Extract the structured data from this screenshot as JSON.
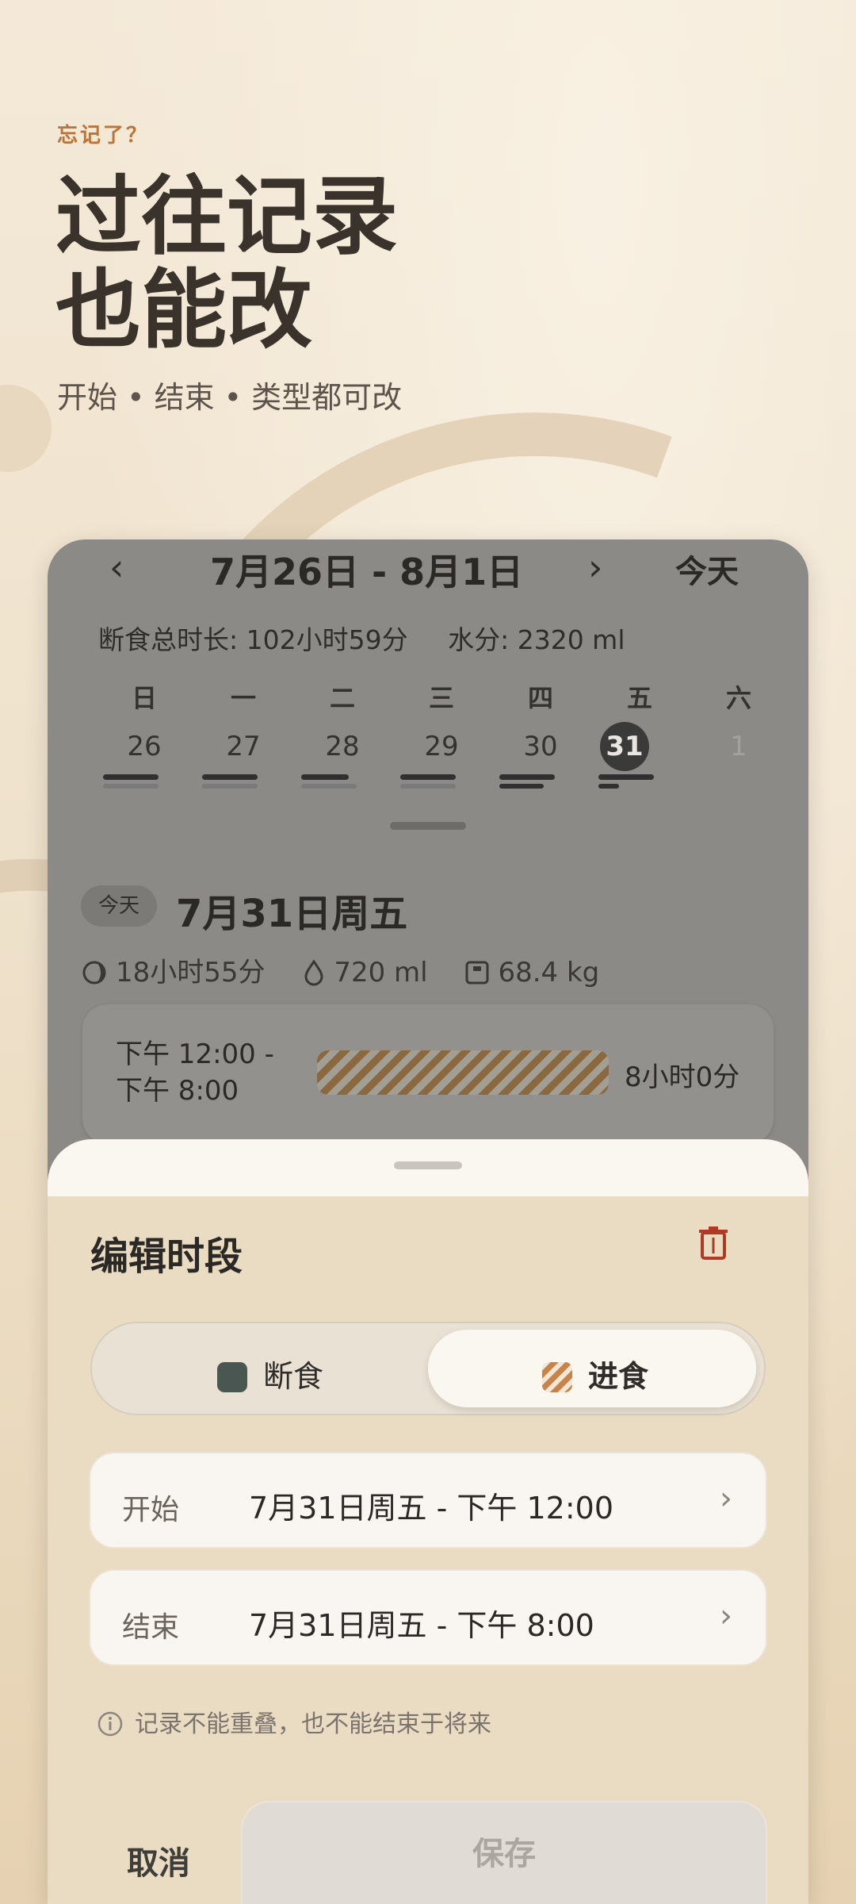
{
  "intro": {
    "eyebrow": "忘记了？",
    "headline_line1": "过往记录",
    "headline_line2": "也能改",
    "subtitle": "开始 • 结束 • 类型都可改"
  },
  "calendar": {
    "prev_icon": "chevron-left-icon",
    "next_icon": "chevron-right-icon",
    "range": "7月26日 - 8月1日",
    "today_button": "今天",
    "summary_fast": "断食总时长: 102小时59分",
    "summary_water": "水分:  2320 ml",
    "weekdays": [
      "日",
      "一",
      "二",
      "三",
      "四",
      "五",
      "六"
    ],
    "days": [
      "26",
      "27",
      "28",
      "29",
      "30",
      "31",
      "1"
    ],
    "selected_day": "31",
    "day_pill": "今天",
    "day_title": "7月31日周五",
    "stats": {
      "fast": "18小时55分",
      "water": "720 ml",
      "weight": "68.4 kg"
    },
    "entry": {
      "time": "下午 12:00 - 下午 8:00",
      "duration": "8小时0分"
    }
  },
  "sheet": {
    "title": "编辑时段",
    "delete_icon": "trash-icon",
    "options": {
      "fasting": "断食",
      "eating": "进食"
    },
    "selected": "eating",
    "start_label": "开始",
    "start_value": "7月31日周五 - 下午 12:00",
    "end_label": "结束",
    "end_value": "7月31日周五 - 下午 8:00",
    "note": "记录不能重叠，也不能结束于将来",
    "cancel": "取消",
    "save": "保存",
    "colors": {
      "accent": "#b8743a",
      "delete": "#b03a26",
      "fast": "#4a5652",
      "eat": "#c8834a"
    }
  }
}
